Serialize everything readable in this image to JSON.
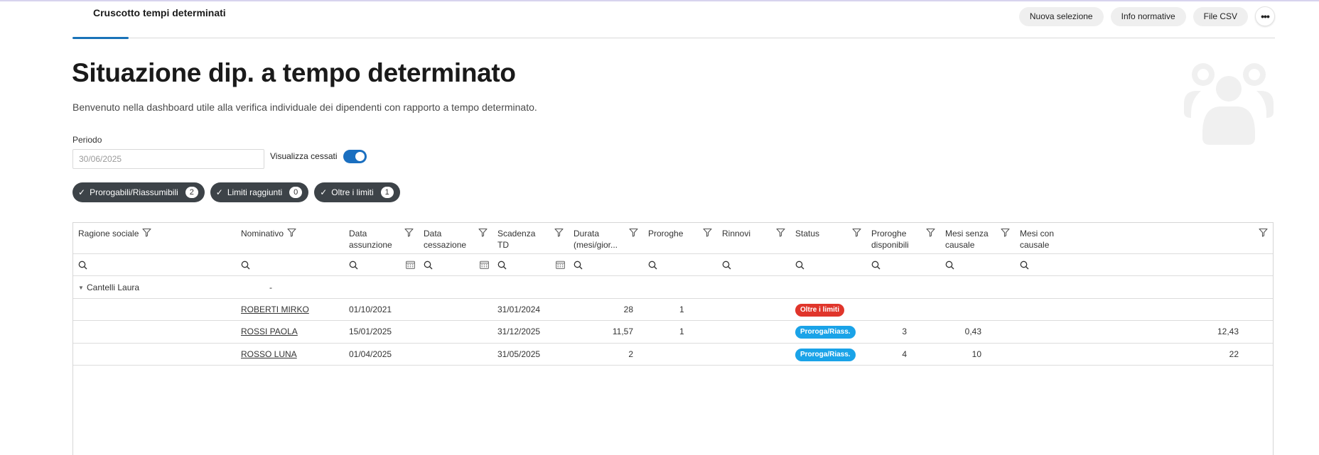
{
  "header": {
    "tab_label": "Cruscotto tempi determinati",
    "actions": [
      "Nuova selezione",
      "Info normative",
      "File CSV"
    ],
    "more_icon": "more-horizontal-icon",
    "accent_color": "#1a73b8"
  },
  "page": {
    "title": "Situazione dip. a tempo determinato",
    "subtitle": "Benvenuto nella dashboard utile alla verifica individuale dei dipendenti con rapporto a tempo determinato.",
    "illustration_icon": "people-group-icon"
  },
  "filters": {
    "periodo_label": "Periodo",
    "periodo_value": "30/06/2025",
    "toggle_label": "Visualizza cessati",
    "toggle_on": true,
    "chips": [
      {
        "label": "Prorogabili/Riassumibili",
        "count": "2"
      },
      {
        "label": "Limiti raggiunti",
        "count": "0"
      },
      {
        "label": "Oltre i limiti",
        "count": "1"
      }
    ]
  },
  "table": {
    "columns": [
      {
        "key": "ragione",
        "label": "Ragione sociale",
        "label2": ""
      },
      {
        "key": "nominativo",
        "label": "Nominativo",
        "label2": ""
      },
      {
        "key": "assunzione",
        "label": "Data",
        "label2": "assunzione"
      },
      {
        "key": "cessazione",
        "label": "Data",
        "label2": "cessazione"
      },
      {
        "key": "scadenza",
        "label": "Scadenza",
        "label2": "TD"
      },
      {
        "key": "durata",
        "label": "Durata",
        "label2": "(mesi/gior..."
      },
      {
        "key": "proroghe",
        "label": "Proroghe",
        "label2": ""
      },
      {
        "key": "rinnovi",
        "label": "Rinnovi",
        "label2": ""
      },
      {
        "key": "status",
        "label": "Status",
        "label2": ""
      },
      {
        "key": "proroghe_disp",
        "label": "Proroghe",
        "label2": "disponibili"
      },
      {
        "key": "mesi_senza",
        "label": "Mesi senza",
        "label2": "causale"
      },
      {
        "key": "mesi_con",
        "label": "Mesi con",
        "label2": "causale"
      }
    ],
    "group": {
      "label": "Cantelli Laura",
      "nominativo": "-"
    },
    "rows": [
      {
        "nominativo": "ROBERTI MIRKO",
        "assunzione": "01/10/2021",
        "cessazione": "",
        "scadenza": "31/01/2024",
        "durata": "28",
        "proroghe": "1",
        "rinnovi": "",
        "status": "Oltre i limiti",
        "status_color": "#e0352b",
        "proroghe_disp": "",
        "mesi_senza": "",
        "mesi_con": ""
      },
      {
        "nominativo": "ROSSI PAOLA",
        "assunzione": "15/01/2025",
        "cessazione": "",
        "scadenza": "31/12/2025",
        "durata": "11,57",
        "proroghe": "1",
        "rinnovi": "",
        "status": "Proroga/Riass.",
        "status_color": "#1aa3e8",
        "proroghe_disp": "3",
        "mesi_senza": "0,43",
        "mesi_con": "12,43"
      },
      {
        "nominativo": "ROSSO LUNA",
        "assunzione": "01/04/2025",
        "cessazione": "",
        "scadenza": "31/05/2025",
        "durata": "2",
        "proroghe": "",
        "rinnovi": "",
        "status": "Proroga/Riass.",
        "status_color": "#1aa3e8",
        "proroghe_disp": "4",
        "mesi_senza": "10",
        "mesi_con": "22"
      }
    ]
  }
}
